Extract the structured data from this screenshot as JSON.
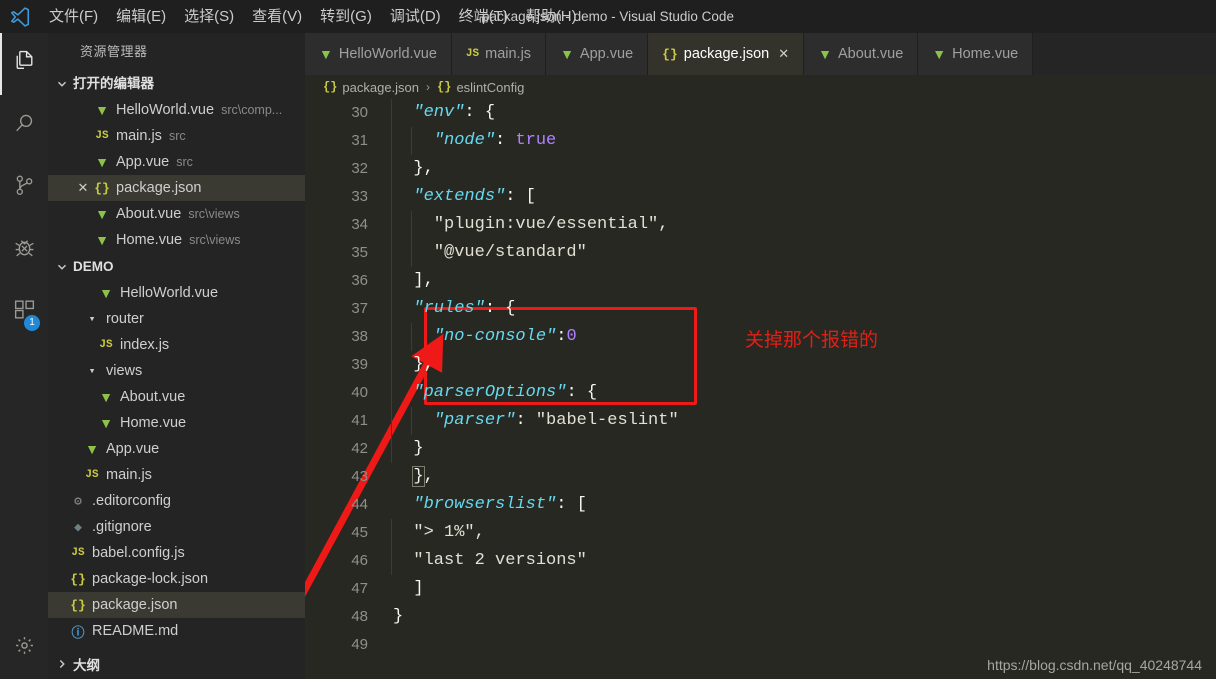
{
  "titlebar": {
    "logo_icon": "vscode-logo-icon",
    "window_title": "package.json - demo - Visual Studio Code",
    "menus": [
      {
        "label": "文件(F)",
        "name": "menu-file"
      },
      {
        "label": "编辑(E)",
        "name": "menu-edit"
      },
      {
        "label": "选择(S)",
        "name": "menu-selection"
      },
      {
        "label": "查看(V)",
        "name": "menu-view"
      },
      {
        "label": "转到(G)",
        "name": "menu-go"
      },
      {
        "label": "调试(D)",
        "name": "menu-debug"
      },
      {
        "label": "终端(T)",
        "name": "menu-terminal"
      },
      {
        "label": "帮助(H)",
        "name": "menu-help"
      }
    ]
  },
  "activitybar": {
    "items": [
      {
        "name": "activity-explorer",
        "icon": "files-icon",
        "active": true,
        "badge": ""
      },
      {
        "name": "activity-search",
        "icon": "search-icon",
        "active": false,
        "badge": ""
      },
      {
        "name": "activity-source-control",
        "icon": "source-control-icon",
        "active": false,
        "badge": ""
      },
      {
        "name": "activity-debug",
        "icon": "debug-bug-icon",
        "active": false,
        "badge": ""
      },
      {
        "name": "activity-extensions",
        "icon": "extensions-icon",
        "active": false,
        "badge": "1"
      }
    ],
    "settings": {
      "name": "activity-settings",
      "icon": "gear-icon"
    }
  },
  "sidebar": {
    "title": "资源管理器",
    "open_editors": {
      "header": "打开的编辑器",
      "expanded": true,
      "items": [
        {
          "icon": "vue",
          "label": "HelloWorld.vue",
          "desc": "src\\comp...",
          "selected": false,
          "dirty": false
        },
        {
          "icon": "js",
          "label": "main.js",
          "desc": "src",
          "selected": false,
          "dirty": false
        },
        {
          "icon": "vue",
          "label": "App.vue",
          "desc": "src",
          "selected": false,
          "dirty": false
        },
        {
          "icon": "json",
          "label": "package.json",
          "desc": "",
          "selected": true,
          "dirty": false
        },
        {
          "icon": "vue",
          "label": "About.vue",
          "desc": "src\\views",
          "selected": false,
          "dirty": false
        },
        {
          "icon": "vue",
          "label": "Home.vue",
          "desc": "src\\views",
          "selected": false,
          "dirty": false
        }
      ]
    },
    "project": {
      "header": "DEMO",
      "expanded": true,
      "items": [
        {
          "icon": "vue",
          "label": "HelloWorld.vue",
          "indent": 3,
          "type": "file",
          "selected": false
        },
        {
          "icon": "folder",
          "label": "router",
          "indent": 2,
          "type": "folder",
          "selected": false
        },
        {
          "icon": "js",
          "label": "index.js",
          "indent": 3,
          "type": "file",
          "selected": false
        },
        {
          "icon": "folder",
          "label": "views",
          "indent": 2,
          "type": "folder",
          "selected": false
        },
        {
          "icon": "vue",
          "label": "About.vue",
          "indent": 3,
          "type": "file",
          "selected": false
        },
        {
          "icon": "vue",
          "label": "Home.vue",
          "indent": 3,
          "type": "file",
          "selected": false
        },
        {
          "icon": "vue",
          "label": "App.vue",
          "indent": 2,
          "type": "file",
          "selected": false
        },
        {
          "icon": "js",
          "label": "main.js",
          "indent": 2,
          "type": "file",
          "selected": false
        },
        {
          "icon": "gear",
          "label": ".editorconfig",
          "indent": 1,
          "type": "file",
          "selected": false
        },
        {
          "icon": "git",
          "label": ".gitignore",
          "indent": 1,
          "type": "file",
          "selected": false
        },
        {
          "icon": "js",
          "label": "babel.config.js",
          "indent": 1,
          "type": "file",
          "selected": false
        },
        {
          "icon": "json",
          "label": "package-lock.json",
          "indent": 1,
          "type": "file",
          "selected": false
        },
        {
          "icon": "json",
          "label": "package.json",
          "indent": 1,
          "type": "file",
          "selected": true
        },
        {
          "icon": "md",
          "label": "README.md",
          "indent": 1,
          "type": "file",
          "selected": false
        }
      ]
    },
    "outline": {
      "header": "大纲",
      "expanded": false
    }
  },
  "tabs": [
    {
      "name": "tab-helloworld-vue",
      "icon": "vue",
      "label": "HelloWorld.vue",
      "active": false,
      "closable": false
    },
    {
      "name": "tab-main-js",
      "icon": "js",
      "label": "main.js",
      "active": false,
      "closable": false
    },
    {
      "name": "tab-app-vue",
      "icon": "vue",
      "label": "App.vue",
      "active": false,
      "closable": false
    },
    {
      "name": "tab-package-json",
      "icon": "json",
      "label": "package.json",
      "active": true,
      "closable": true
    },
    {
      "name": "tab-about-vue",
      "icon": "vue",
      "label": "About.vue",
      "active": false,
      "closable": false
    },
    {
      "name": "tab-home-vue",
      "icon": "vue",
      "label": "Home.vue",
      "active": false,
      "closable": false
    }
  ],
  "breadcrumbs": [
    {
      "icon": "json",
      "label": "package.json"
    },
    {
      "icon": "json",
      "label": "eslintConfig"
    }
  ],
  "editor": {
    "first_line": 30,
    "lines": [
      {
        "no": 30,
        "indent": 1,
        "tokens": [
          {
            "t": "k",
            "v": "\"env\""
          },
          {
            "t": "p",
            "v": ": {"
          }
        ]
      },
      {
        "no": 31,
        "indent": 2,
        "tokens": [
          {
            "t": "k",
            "v": "\"node\""
          },
          {
            "t": "p",
            "v": ": "
          },
          {
            "t": "bool",
            "v": "true"
          }
        ]
      },
      {
        "no": 32,
        "indent": 1,
        "tokens": [
          {
            "t": "p",
            "v": "},"
          }
        ]
      },
      {
        "no": 33,
        "indent": 1,
        "tokens": [
          {
            "t": "k",
            "v": "\"extends\""
          },
          {
            "t": "p",
            "v": ": ["
          }
        ]
      },
      {
        "no": 34,
        "indent": 2,
        "tokens": [
          {
            "t": "str",
            "v": "\"plugin:vue/essential\","
          }
        ]
      },
      {
        "no": 35,
        "indent": 2,
        "tokens": [
          {
            "t": "str",
            "v": "\"@vue/standard\""
          }
        ]
      },
      {
        "no": 36,
        "indent": 1,
        "tokens": [
          {
            "t": "p",
            "v": "],"
          }
        ]
      },
      {
        "no": 37,
        "indent": 1,
        "tokens": [
          {
            "t": "k",
            "v": "\"rules\""
          },
          {
            "t": "p",
            "v": ": {"
          }
        ]
      },
      {
        "no": 38,
        "indent": 2,
        "tokens": [
          {
            "t": "k",
            "v": "\"no-console\""
          },
          {
            "t": "p",
            "v": ":"
          },
          {
            "t": "num",
            "v": "0"
          }
        ]
      },
      {
        "no": 39,
        "indent": 1,
        "tokens": [
          {
            "t": "p",
            "v": "},"
          }
        ]
      },
      {
        "no": 40,
        "indent": 1,
        "tokens": [
          {
            "t": "k",
            "v": "\"parserOptions\""
          },
          {
            "t": "p",
            "v": ": {"
          }
        ]
      },
      {
        "no": 41,
        "indent": 2,
        "tokens": [
          {
            "t": "k",
            "v": "\"parser\""
          },
          {
            "t": "p",
            "v": ": "
          },
          {
            "t": "str",
            "v": "\"babel-eslint\""
          }
        ]
      },
      {
        "no": 42,
        "indent": 1,
        "tokens": [
          {
            "t": "p",
            "v": "}"
          }
        ]
      },
      {
        "no": 43,
        "indent": 0,
        "tokens": [
          {
            "t": "pm",
            "v": "}"
          },
          {
            "t": "p",
            "v": ","
          }
        ]
      },
      {
        "no": 44,
        "indent": 0,
        "tokens": [
          {
            "t": "k",
            "v": "\"browserslist\""
          },
          {
            "t": "p",
            "v": ": ["
          }
        ]
      },
      {
        "no": 45,
        "indent": 1,
        "tokens": [
          {
            "t": "str",
            "v": "\"> 1%\","
          }
        ]
      },
      {
        "no": 46,
        "indent": 1,
        "tokens": [
          {
            "t": "str",
            "v": "\"last 2 versions\""
          }
        ]
      },
      {
        "no": 47,
        "indent": 0,
        "tokens": [
          {
            "t": "p",
            "v": "]"
          }
        ]
      },
      {
        "no": 48,
        "indent": -1,
        "tokens": [
          {
            "t": "p",
            "v": "}"
          }
        ]
      },
      {
        "no": 49,
        "indent": -1,
        "tokens": []
      }
    ]
  },
  "annotations": {
    "box_color": "#ef1a18",
    "arrow_color": "#ef1a18",
    "note_text": "关掉那个报错的",
    "note_color": "#e21f15"
  },
  "watermark": "https://blog.csdn.net/qq_40248744"
}
